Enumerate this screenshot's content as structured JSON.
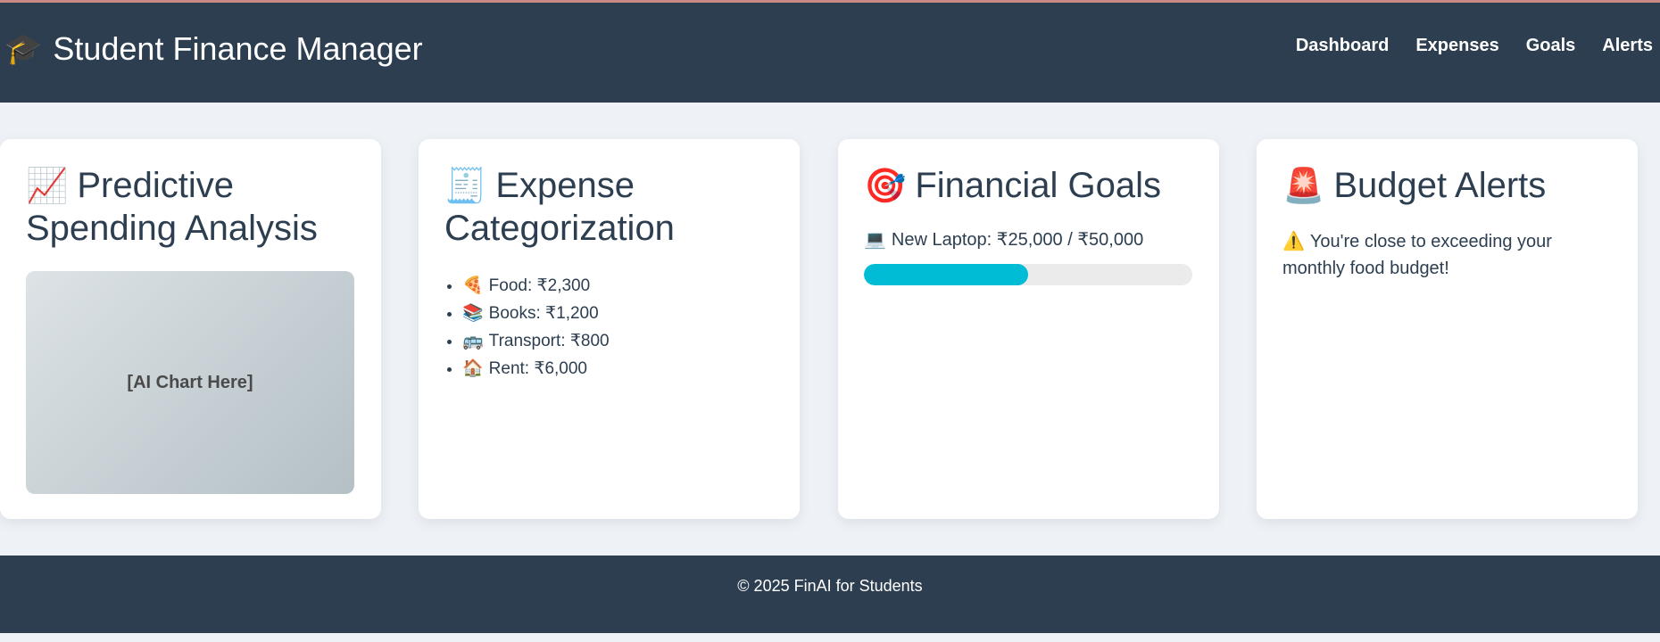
{
  "header": {
    "brand_icon": "🎓",
    "title": "Student Finance Manager",
    "nav": [
      {
        "label": "Dashboard"
      },
      {
        "label": "Expenses"
      },
      {
        "label": "Goals"
      },
      {
        "label": "Alerts"
      }
    ]
  },
  "cards": {
    "analysis": {
      "icon": "📈",
      "title": "Predictive Spending Analysis",
      "chart_placeholder": "[AI Chart Here]"
    },
    "categorization": {
      "icon": "🧾",
      "title": "Expense Categorization",
      "items": [
        {
          "icon": "🍕",
          "text": "Food: ₹2,300"
        },
        {
          "icon": "📚",
          "text": "Books: ₹1,200"
        },
        {
          "icon": "🚌",
          "text": "Transport: ₹800"
        },
        {
          "icon": "🏠",
          "text": "Rent: ₹6,000"
        }
      ]
    },
    "goals": {
      "icon": "🎯",
      "title": "Financial Goals",
      "goal_icon": "💻",
      "goal_text": "New Laptop: ₹25,000 / ₹50,000",
      "progress_fraction": 0.5
    },
    "alerts": {
      "icon": "🚨",
      "title": "Budget Alerts",
      "alert_icon": "⚠️",
      "alert_text": "You're close to exceeding your monthly food budget!"
    }
  },
  "footer": {
    "text": "© 2025 FinAI for Students"
  },
  "colors": {
    "header_bg": "#2c3e50",
    "page_bg": "#eef2f7",
    "progress": "#00bcd4"
  }
}
